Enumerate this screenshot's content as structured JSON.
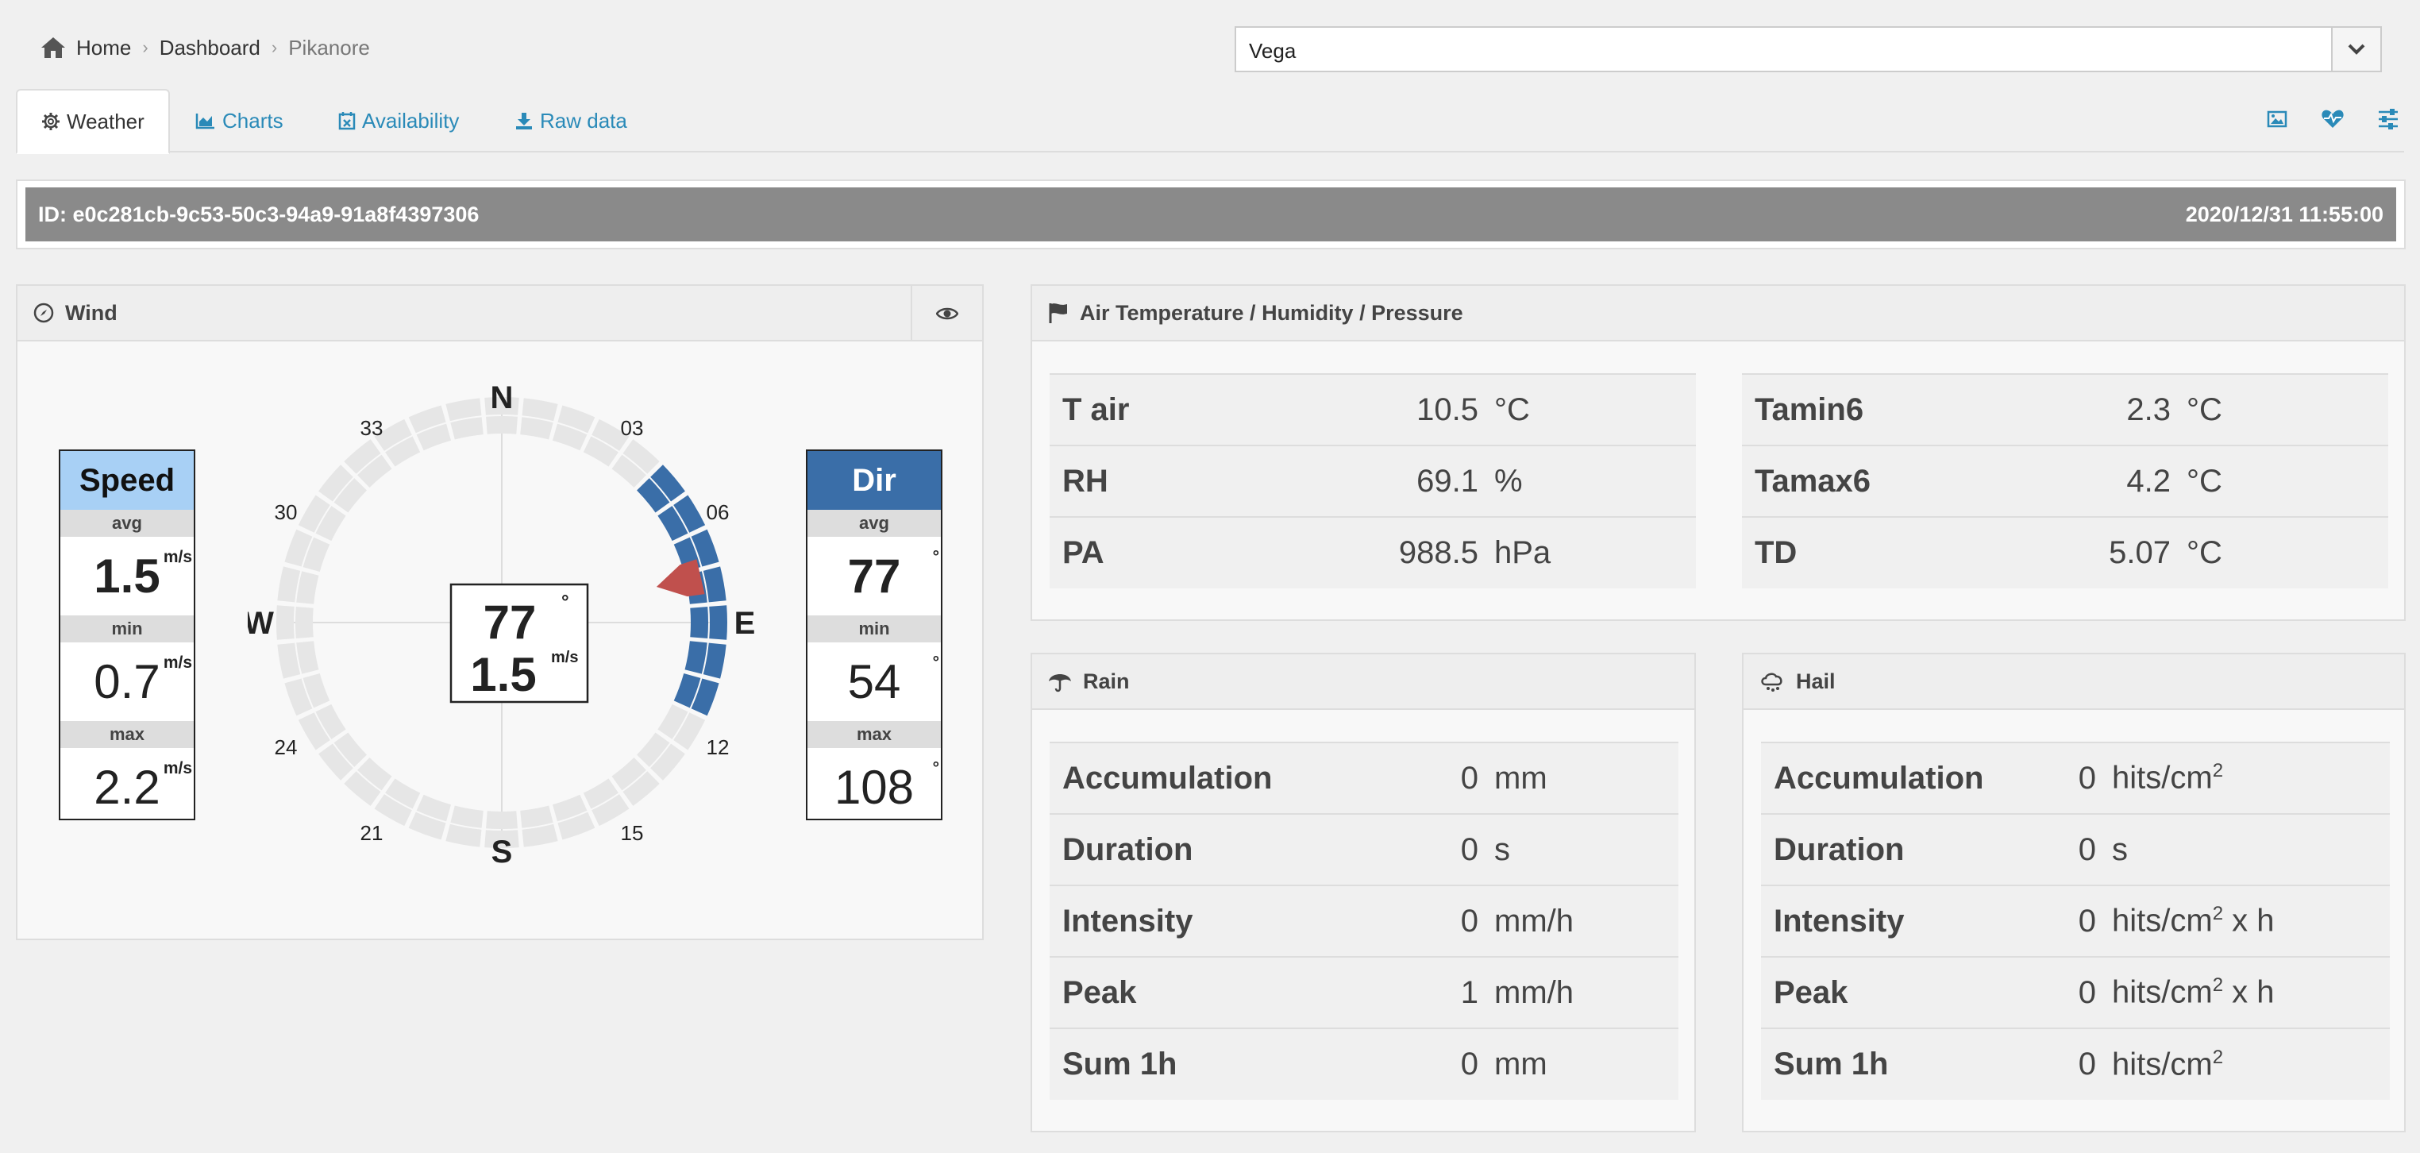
{
  "breadcrumb": {
    "home": "Home",
    "dashboard": "Dashboard",
    "current": "Pikanore"
  },
  "station_select": {
    "value": "Vega"
  },
  "tabs": [
    {
      "label": "Weather"
    },
    {
      "label": "Charts"
    },
    {
      "label": "Availability"
    },
    {
      "label": "Raw data"
    }
  ],
  "id_bar": {
    "id": "ID: e0c281cb-9c53-50c3-94a9-91a8f4397306",
    "timestamp": "2020/12/31 11:55:00"
  },
  "wind": {
    "title": "Wind",
    "speed": {
      "title": "Speed",
      "avg_label": "avg",
      "avg": "1.5",
      "min_label": "min",
      "min": "0.7",
      "max_label": "max",
      "max": "2.2",
      "unit": "m/s"
    },
    "dir": {
      "title": "Dir",
      "avg_label": "avg",
      "avg": "77",
      "min_label": "min",
      "min": "54",
      "max_label": "max",
      "max": "108",
      "unit": "°"
    },
    "compass": {
      "center_dir": "77",
      "center_dir_unit": "°",
      "center_speed": "1.5",
      "center_speed_unit": "m/s",
      "labels": {
        "n": "N",
        "e": "E",
        "s": "S",
        "w": "W",
        "t03": "03",
        "t06": "06",
        "t12": "12",
        "t15": "15",
        "t21": "21",
        "t24": "24",
        "t30": "30",
        "t33": "33"
      },
      "direction_deg": 77,
      "range_min_deg": 54,
      "range_max_deg": 108
    },
    "colors": {
      "range": "#3a6ea8",
      "pointer": "#c0504d",
      "ring": "#e6e6e6"
    }
  },
  "air": {
    "title": "Air Temperature / Humidity / Pressure",
    "left": [
      {
        "label": "T air",
        "value": "10.5",
        "unit": "°C"
      },
      {
        "label": "RH",
        "value": "69.1",
        "unit": "%"
      },
      {
        "label": "PA",
        "value": "988.5",
        "unit": "hPa"
      }
    ],
    "right": [
      {
        "label": "Tamin6",
        "value": "2.3",
        "unit": "°C"
      },
      {
        "label": "Tamax6",
        "value": "4.2",
        "unit": "°C"
      },
      {
        "label": "TD",
        "value": "5.07",
        "unit": "°C"
      }
    ]
  },
  "rain": {
    "title": "Rain",
    "rows": [
      {
        "label": "Accumulation",
        "value": "0",
        "unit": "mm"
      },
      {
        "label": "Duration",
        "value": "0",
        "unit": "s"
      },
      {
        "label": "Intensity",
        "value": "0",
        "unit": "mm/h"
      },
      {
        "label": "Peak",
        "value": "1",
        "unit": "mm/h"
      },
      {
        "label": "Sum 1h",
        "value": "0",
        "unit": "mm"
      }
    ]
  },
  "hail": {
    "title": "Hail",
    "sup": "2",
    "rows": [
      {
        "label": "Accumulation",
        "value": "0",
        "unit": "hits/cm",
        "unit_after": ""
      },
      {
        "label": "Duration",
        "value": "0",
        "unit": "s"
      },
      {
        "label": "Intensity",
        "value": "0",
        "unit": "hits/cm",
        "unit_after": " x h"
      },
      {
        "label": "Peak",
        "value": "0",
        "unit": "hits/cm",
        "unit_after": " x h"
      },
      {
        "label": "Sum 1h",
        "value": "0",
        "unit": "hits/cm",
        "unit_after": ""
      }
    ]
  }
}
